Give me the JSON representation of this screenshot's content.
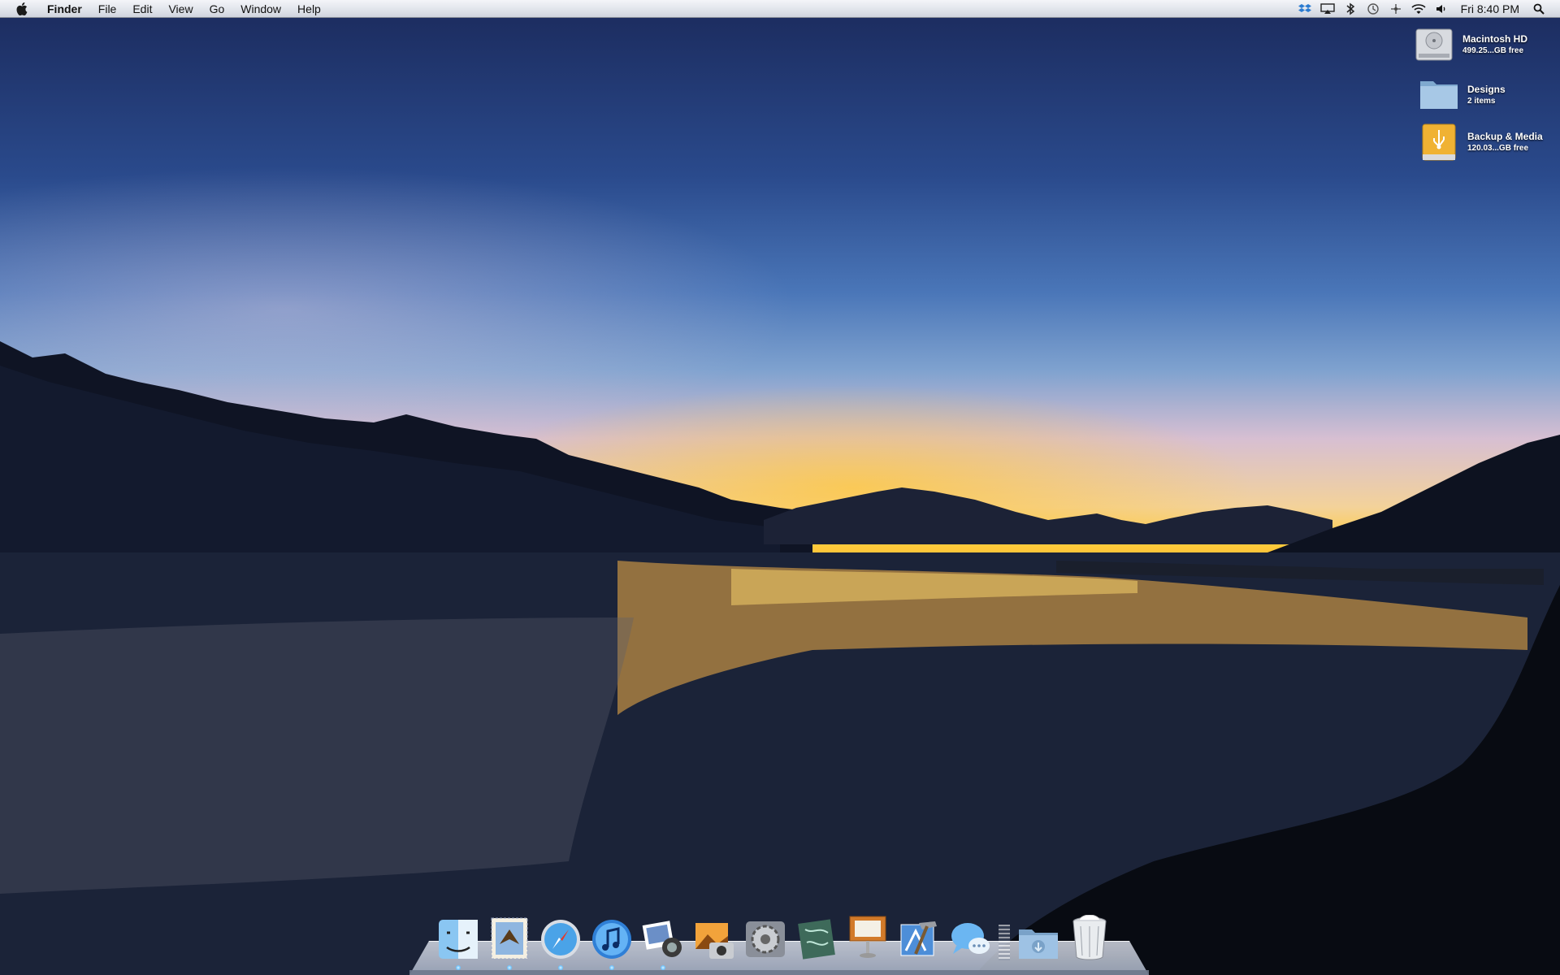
{
  "menubar": {
    "app_name": "Finder",
    "menus": [
      "File",
      "Edit",
      "View",
      "Go",
      "Window",
      "Help"
    ],
    "status_icons": [
      "dropbox-icon",
      "airplay-icon",
      "bluetooth-icon",
      "time-machine-icon",
      "sync-icon",
      "wifi-icon",
      "volume-icon"
    ],
    "clock": "Fri 8:40 PM",
    "search_icon": "spotlight-icon"
  },
  "desktop_items": [
    {
      "name": "Macintosh HD",
      "detail": "499.25...GB free",
      "icon": "hard-drive-icon"
    },
    {
      "name": "Designs",
      "detail": "2 items",
      "icon": "folder-icon"
    },
    {
      "name": "Backup & Media",
      "detail": "120.03...GB free",
      "icon": "usb-drive-icon"
    }
  ],
  "dock": {
    "apps": [
      {
        "icon": "finder-icon",
        "running": true
      },
      {
        "icon": "mail-icon",
        "running": true
      },
      {
        "icon": "safari-icon",
        "running": true
      },
      {
        "icon": "itunes-icon",
        "running": true
      },
      {
        "icon": "iphoto-icon",
        "running": true
      },
      {
        "icon": "image-capture-icon",
        "running": false
      },
      {
        "icon": "system-preferences-icon",
        "running": false
      },
      {
        "icon": "maps-app-icon",
        "running": false
      },
      {
        "icon": "keynote-icon",
        "running": false
      },
      {
        "icon": "xcode-icon",
        "running": false
      },
      {
        "icon": "messages-icon",
        "running": false
      }
    ],
    "right": [
      {
        "icon": "downloads-folder-icon"
      },
      {
        "icon": "trash-icon"
      }
    ]
  },
  "colors": {
    "menubar_bg": "#dfe3ea",
    "sky_top": "#1b2a5c",
    "sunset": "#ffcb3a",
    "water": "#1d2740"
  }
}
